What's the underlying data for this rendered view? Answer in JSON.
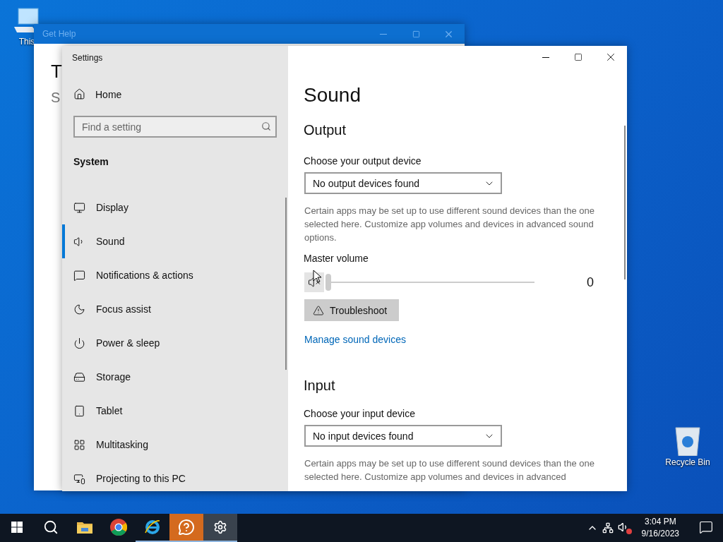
{
  "desktop": {
    "icons": [
      {
        "label": "This"
      },
      {
        "label": "Recycle Bin"
      }
    ]
  },
  "background_window": {
    "title": "Get Help",
    "heading": "T",
    "subheading": "S"
  },
  "settings": {
    "title": "Settings",
    "home": "Home",
    "search": {
      "placeholder": "Find a setting"
    },
    "section": "System",
    "items": [
      {
        "label": "Display",
        "selected": false
      },
      {
        "label": "Sound",
        "selected": true
      },
      {
        "label": "Notifications & actions",
        "selected": false
      },
      {
        "label": "Focus assist",
        "selected": false
      },
      {
        "label": "Power & sleep",
        "selected": false
      },
      {
        "label": "Storage",
        "selected": false
      },
      {
        "label": "Tablet",
        "selected": false
      },
      {
        "label": "Multitasking",
        "selected": false
      },
      {
        "label": "Projecting to this PC",
        "selected": false
      }
    ],
    "page": {
      "title": "Sound",
      "output": {
        "heading": "Output",
        "device_label": "Choose your output device",
        "device": "No output devices found",
        "description": "Certain apps may be set up to use different sound devices than the one selected here. Customize app volumes and devices in advanced sound options.",
        "volume_label": "Master volume",
        "muted": true,
        "level": 0,
        "reading": "0",
        "troubleshoot": "Troubleshoot",
        "link": "Manage sound devices"
      },
      "input": {
        "heading": "Input",
        "device_label": "Choose your input device",
        "device": "No input devices found",
        "description": "Certain apps may be set up to use different sound devices than the one selected here. Customize app volumes and devices in advanced"
      }
    }
  },
  "taskbar": {
    "apps": [
      {
        "kind": "start",
        "running": false,
        "selected": false
      },
      {
        "kind": "search",
        "running": false,
        "selected": false
      },
      {
        "kind": "folder",
        "running": false,
        "selected": false
      },
      {
        "kind": "chrome",
        "running": false,
        "selected": false
      },
      {
        "kind": "ie",
        "running": true,
        "selected": false
      },
      {
        "kind": "help",
        "running": true,
        "selected": false
      },
      {
        "kind": "settings",
        "running": true,
        "selected": true
      }
    ],
    "volume_muted": true,
    "time": "3:04 PM",
    "date": "9/16/2023"
  }
}
